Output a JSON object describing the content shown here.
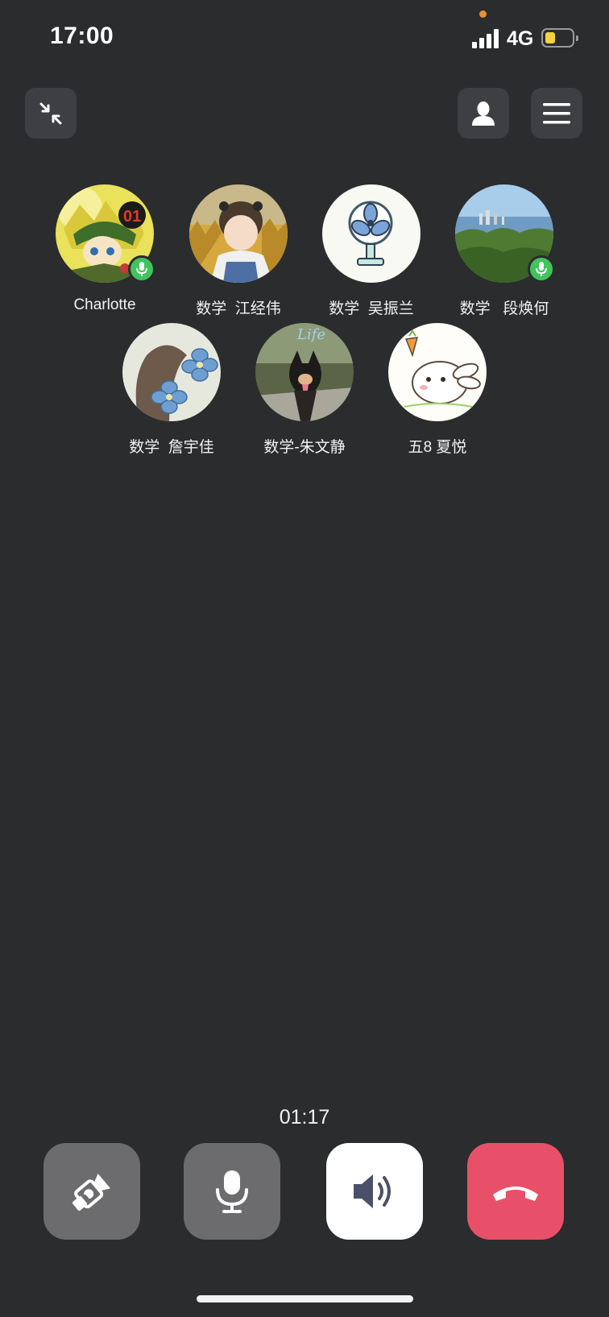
{
  "status_bar": {
    "time": "17:00",
    "network": "4G",
    "battery_level": 0.35,
    "signal_bars": 4
  },
  "top_bar": {
    "minimize_icon": "collapse-arrows-icon",
    "contacts_icon": "person-icon",
    "menu_icon": "hamburger-menu-icon"
  },
  "participants": [
    {
      "name": "Charlotte",
      "mic_active": true
    },
    {
      "name": "数学  江经伟",
      "mic_active": false
    },
    {
      "name": "数学  吴振兰",
      "mic_active": false
    },
    {
      "name": "数学   段焕何",
      "mic_active": true
    },
    {
      "name": "数学  詹宇佳",
      "mic_active": false
    },
    {
      "name": "数学-朱文静",
      "mic_active": false
    },
    {
      "name": "五8 夏悦",
      "mic_active": false
    }
  ],
  "call": {
    "duration": "01:17"
  },
  "controls": [
    {
      "icon": "camera-off-icon",
      "active": false
    },
    {
      "icon": "microphone-icon",
      "active": false
    },
    {
      "icon": "speaker-icon",
      "active": true
    },
    {
      "icon": "hang-up-icon",
      "active": false
    }
  ],
  "colors": {
    "background": "#2b2c2e",
    "button_gray": "#6c6c6f",
    "hangup_red": "#e8506a",
    "mic_green": "#3fc55b"
  }
}
